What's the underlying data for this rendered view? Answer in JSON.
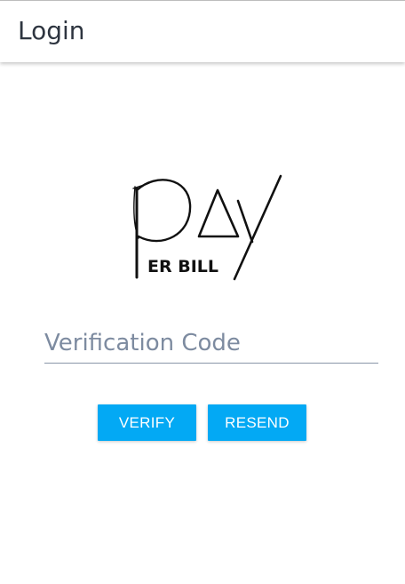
{
  "header": {
    "title": "Login"
  },
  "logo": {
    "tagline": "ER BILL"
  },
  "verification": {
    "placeholder": "Verification Code",
    "value": ""
  },
  "actions": {
    "verify_label": "VERIFY",
    "resend_label": "RESEND"
  },
  "colors": {
    "accent": "#03a9f4",
    "header_text": "#2e3540",
    "placeholder": "#7d8ba0",
    "underline": "#8a96a8"
  }
}
